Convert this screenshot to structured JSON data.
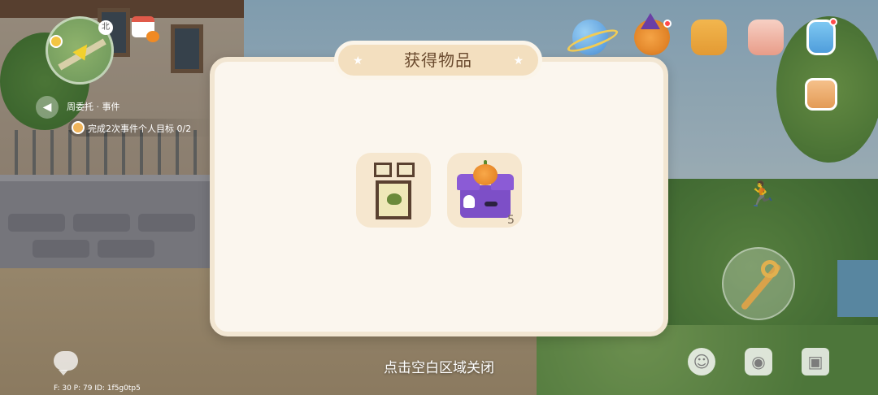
{
  "dialog": {
    "title": "获得物品",
    "items": [
      {
        "name_icon": "butterfly-frame-icon",
        "count": ""
      },
      {
        "name_icon": "halloween-gift-box-icon",
        "count": "5"
      }
    ],
    "close_hint": "点击空白区域关闭"
  },
  "hud": {
    "minimap_north": "北",
    "quest_title": "周委托 · 事件",
    "quest_objective": "完成2次事件个人目标 0/2",
    "debug_info": "F: 30    P: 79    ID: 1f5g0tp5"
  },
  "icons": {
    "top_right": [
      "planet-icon",
      "halloween-event-icon",
      "shop-icon",
      "basket-icon",
      "phone-icon"
    ],
    "side": [
      "backpack-icon"
    ],
    "bottom": [
      "chat-icon",
      "emote-icon",
      "camera-icon",
      "toolbox-icon"
    ]
  },
  "colors": {
    "dialog_bg": "#fbf6ee",
    "title_tab": "#f3dfbf",
    "item_card": "#f6e7cf",
    "title_text": "#6a4a2e"
  }
}
